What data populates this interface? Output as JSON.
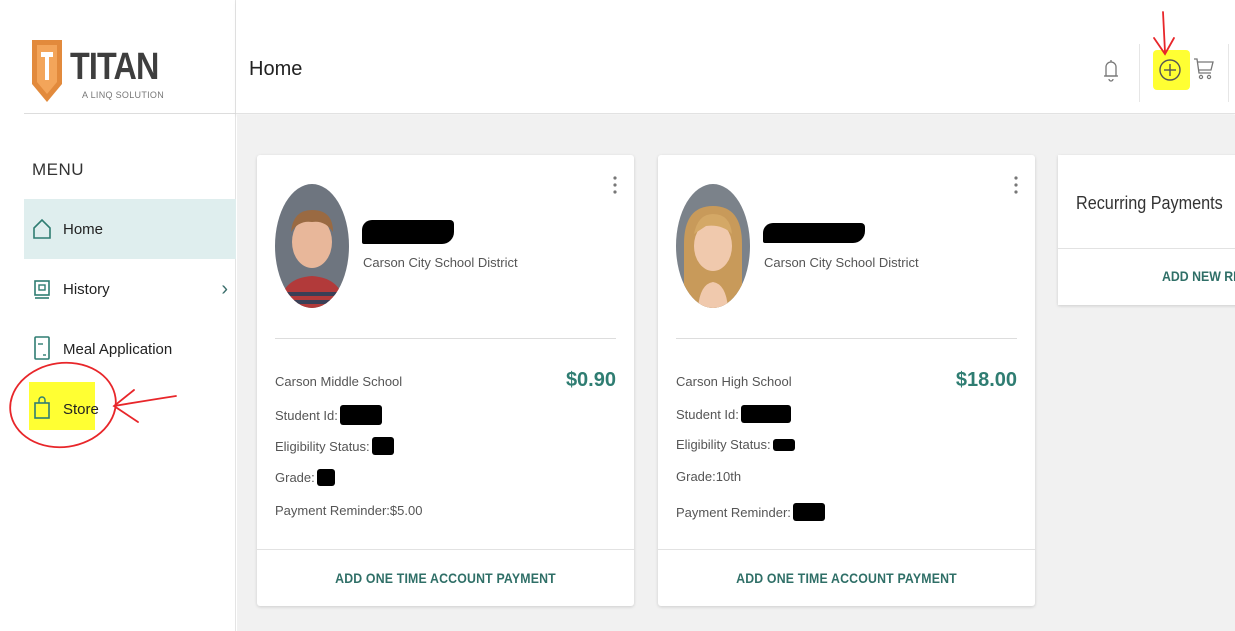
{
  "brand": {
    "name": "TITAN",
    "tagline": "A LINQ SOLUTION",
    "accent": "#2f7d72",
    "logo_color": "#e28a3c"
  },
  "sidebar": {
    "menu_label": "MENU",
    "items": [
      {
        "label": "Home",
        "icon": "home-icon",
        "active": true
      },
      {
        "label": "History",
        "icon": "history-icon",
        "has_chevron": true
      },
      {
        "label": "Meal Application",
        "icon": "document-icon"
      },
      {
        "label": "Store",
        "icon": "shopping-bag-icon",
        "highlighted": true
      }
    ]
  },
  "header": {
    "title": "Home",
    "icons": [
      "bell-icon",
      "plus-circle-icon",
      "cart-icon"
    ]
  },
  "students": [
    {
      "district": "Carson City School District",
      "school": "Carson Middle School",
      "balance": "$0.90",
      "student_id_label": "Student Id:",
      "eligibility_label": "Eligibility Status:",
      "grade_label": "Grade:",
      "grade_value": "",
      "reminder_label": "Payment Reminder:",
      "reminder_value": " $5.00",
      "action": "ADD ONE TIME ACCOUNT PAYMENT"
    },
    {
      "district": "Carson City School District",
      "school": "Carson High School",
      "balance": "$18.00",
      "student_id_label": "Student Id:",
      "eligibility_label": "Eligibility Status:",
      "grade_label": "Grade:",
      "grade_value": " 10th",
      "reminder_label": "Payment Reminder:",
      "reminder_value": "",
      "action": "ADD ONE TIME ACCOUNT PAYMENT"
    }
  ],
  "recurring": {
    "title": "Recurring Payments",
    "add_label": "ADD NEW REC"
  }
}
